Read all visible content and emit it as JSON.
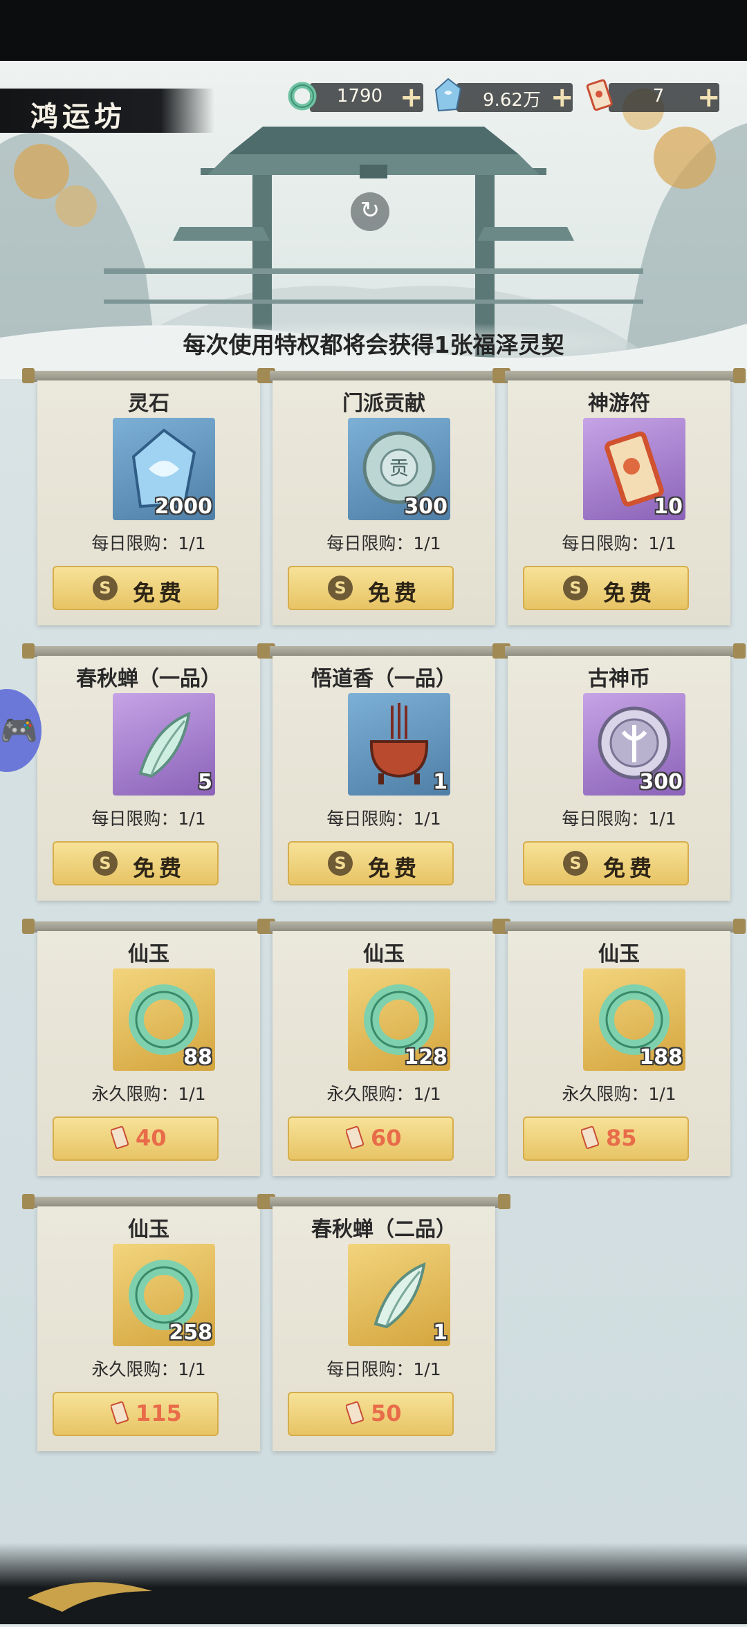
{
  "header": {
    "title": "鸿运坊"
  },
  "resources": [
    {
      "icon": "jade-ring-icon",
      "value": "1790"
    },
    {
      "icon": "spirit-stone-icon",
      "value": "9.62万"
    },
    {
      "icon": "talisman-ticket-icon",
      "value": "7"
    }
  ],
  "refresh_icon": "refresh-icon",
  "notice": "每次使用特权都将会获得1张福泽灵契",
  "items": [
    {
      "name": "灵石",
      "qty": "2000",
      "limit": "每日限购：1/1",
      "button": "免费",
      "bg": "blue",
      "icon": "spirit-stone-icon"
    },
    {
      "name": "门派贡献",
      "qty": "300",
      "limit": "每日限购：1/1",
      "button": "免费",
      "bg": "blue",
      "icon": "sect-token-icon"
    },
    {
      "name": "神游符",
      "qty": "10",
      "limit": "每日限购：1/1",
      "button": "免费",
      "bg": "purple",
      "icon": "talisman-icon"
    },
    {
      "name": "春秋蝉（一品）",
      "qty": "5",
      "limit": "每日限购：1/1",
      "button": "免费",
      "bg": "purple",
      "icon": "jade-cicada-icon"
    },
    {
      "name": "悟道香（一品）",
      "qty": "1",
      "limit": "每日限购：1/1",
      "button": "免费",
      "bg": "blue",
      "icon": "incense-burner-icon"
    },
    {
      "name": "古神币",
      "qty": "300",
      "limit": "每日限购：1/1",
      "button": "免费",
      "bg": "purple",
      "icon": "ancient-coin-icon"
    },
    {
      "name": "仙玉",
      "qty": "88",
      "limit": "永久限购：1/1",
      "price": "40",
      "bg": "gold",
      "icon": "jade-ring-icon"
    },
    {
      "name": "仙玉",
      "qty": "128",
      "limit": "永久限购：1/1",
      "price": "60",
      "bg": "gold",
      "icon": "jade-ring-icon"
    },
    {
      "name": "仙玉",
      "qty": "188",
      "limit": "永久限购：1/1",
      "price": "85",
      "bg": "gold",
      "icon": "jade-ring-icon"
    },
    {
      "name": "仙玉",
      "qty": "258",
      "limit": "永久限购：1/1",
      "price": "115",
      "bg": "gold",
      "icon": "jade-ring-icon"
    },
    {
      "name": "春秋蝉（二品）",
      "qty": "1",
      "limit": "每日限购：1/1",
      "price": "50",
      "bg": "gold",
      "icon": "jade-cicada-icon"
    }
  ],
  "side_button_icon": "gamepad-icon"
}
